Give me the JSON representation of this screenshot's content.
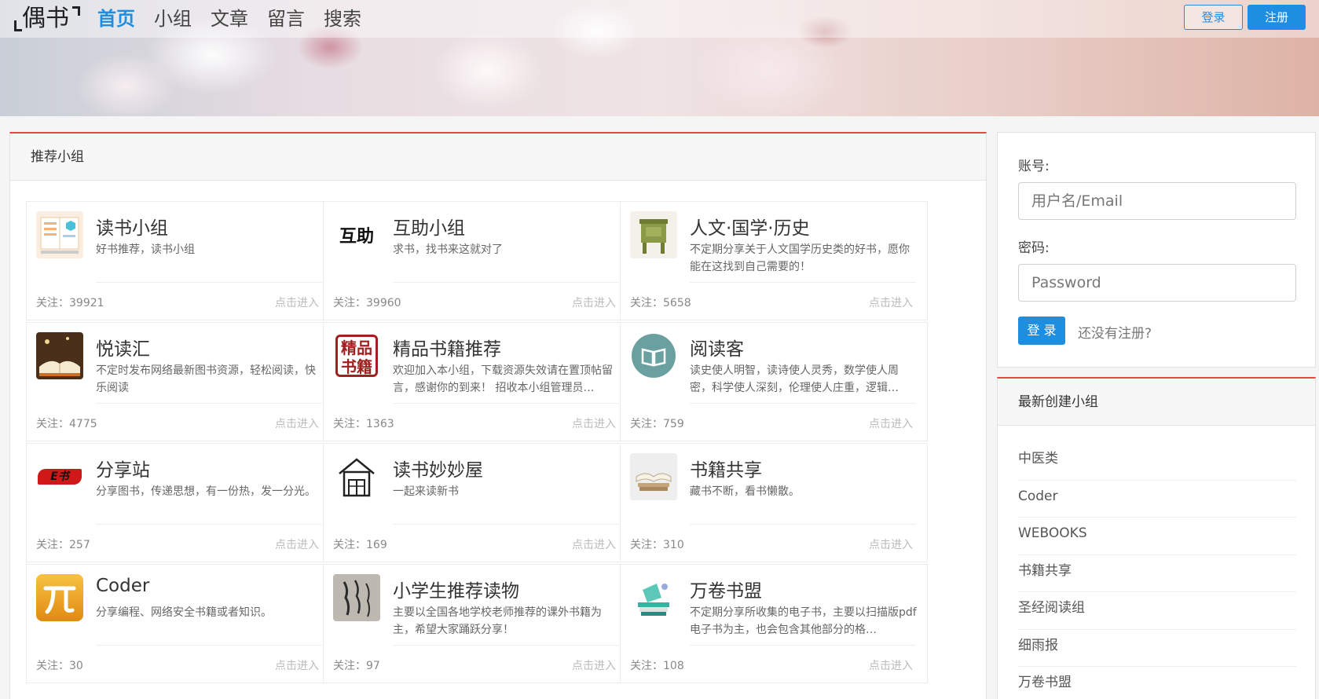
{
  "nav": {
    "logo": "偶书",
    "links": [
      "首页",
      "小组",
      "文章",
      "留言",
      "搜索"
    ],
    "login_label": "登录",
    "register_label": "注册"
  },
  "main": {
    "section_title": "推荐小组",
    "follow_prefix": "关注：",
    "enter_label": "点击进入",
    "groups": [
      {
        "name": "读书小组",
        "desc": "好书推荐，读书小组",
        "followers": "39921",
        "icon": "book-icon"
      },
      {
        "name": "互助小组",
        "desc": "求书，找书来这就对了",
        "followers": "39960",
        "icon": "huzhu-logo-icon",
        "icon_text": "互助"
      },
      {
        "name": "人文·国学·历史",
        "desc": "不定期分享关于人文国学历史类的好书，愿你能在这找到自己需要的！",
        "followers": "5658",
        "icon": "bronze-vessel-icon"
      },
      {
        "name": "悦读汇",
        "desc": "不定时发布网络最新图书资源，轻松阅读，快乐阅读",
        "followers": "4775",
        "icon": "open-book-photo-icon"
      },
      {
        "name": "精品书籍推荐",
        "desc": "欢迎加入本小组，下载资源失效请在置顶帖留言，感谢你的到来！ 招收本小组管理员…",
        "followers": "1363",
        "icon": "seal-icon",
        "icon_text": "精品书籍"
      },
      {
        "name": "阅读客",
        "desc": "读史使人明智，读诗使人灵秀，数学使人周密，科学使人深刻，伦理使人庄重，逻辑…",
        "followers": "759",
        "icon": "book-circle-icon"
      },
      {
        "name": "分享站",
        "desc": "分享图书，传递思想，有一份热，发一分光。",
        "followers": "257",
        "icon": "brush-stroke-icon",
        "icon_text": "E书"
      },
      {
        "name": "读书妙妙屋",
        "desc": "一起来读新书",
        "followers": "169",
        "icon": "house-icon"
      },
      {
        "name": "书籍共享",
        "desc": "藏书不断，看书懒散。",
        "followers": "310",
        "icon": "stacked-books-icon"
      },
      {
        "name": "Coder",
        "desc": "分享编程、网络安全书籍或者知识。",
        "followers": "30",
        "icon": "pi-icon"
      },
      {
        "name": "小学生推荐读物",
        "desc": "主要以全国各地学校老师推荐的课外书籍为主，希望大家踊跃分享！",
        "followers": "97",
        "icon": "calligraphy-icon"
      },
      {
        "name": "万卷书盟",
        "desc": "不定期分享所收集的电子书，主要以扫描版pdf电子书为主，也会包含其他部分的格…",
        "followers": "108",
        "icon": "book-stack-icon"
      }
    ]
  },
  "sidebar": {
    "account_label": "账号:",
    "account_placeholder": "用户名/Email",
    "password_label": "密码:",
    "password_placeholder": "Password",
    "submit_label": "登 录",
    "register_prompt": "还没有注册?",
    "new_groups_title": "最新创建小组",
    "new_groups": [
      "中医类",
      "Coder",
      "WEBOOKS",
      "书籍共享",
      "圣经阅读组",
      "细雨报",
      "万卷书盟"
    ]
  },
  "colors": {
    "accent": "#1e8fe0",
    "panel_top_border": "#e64646"
  }
}
